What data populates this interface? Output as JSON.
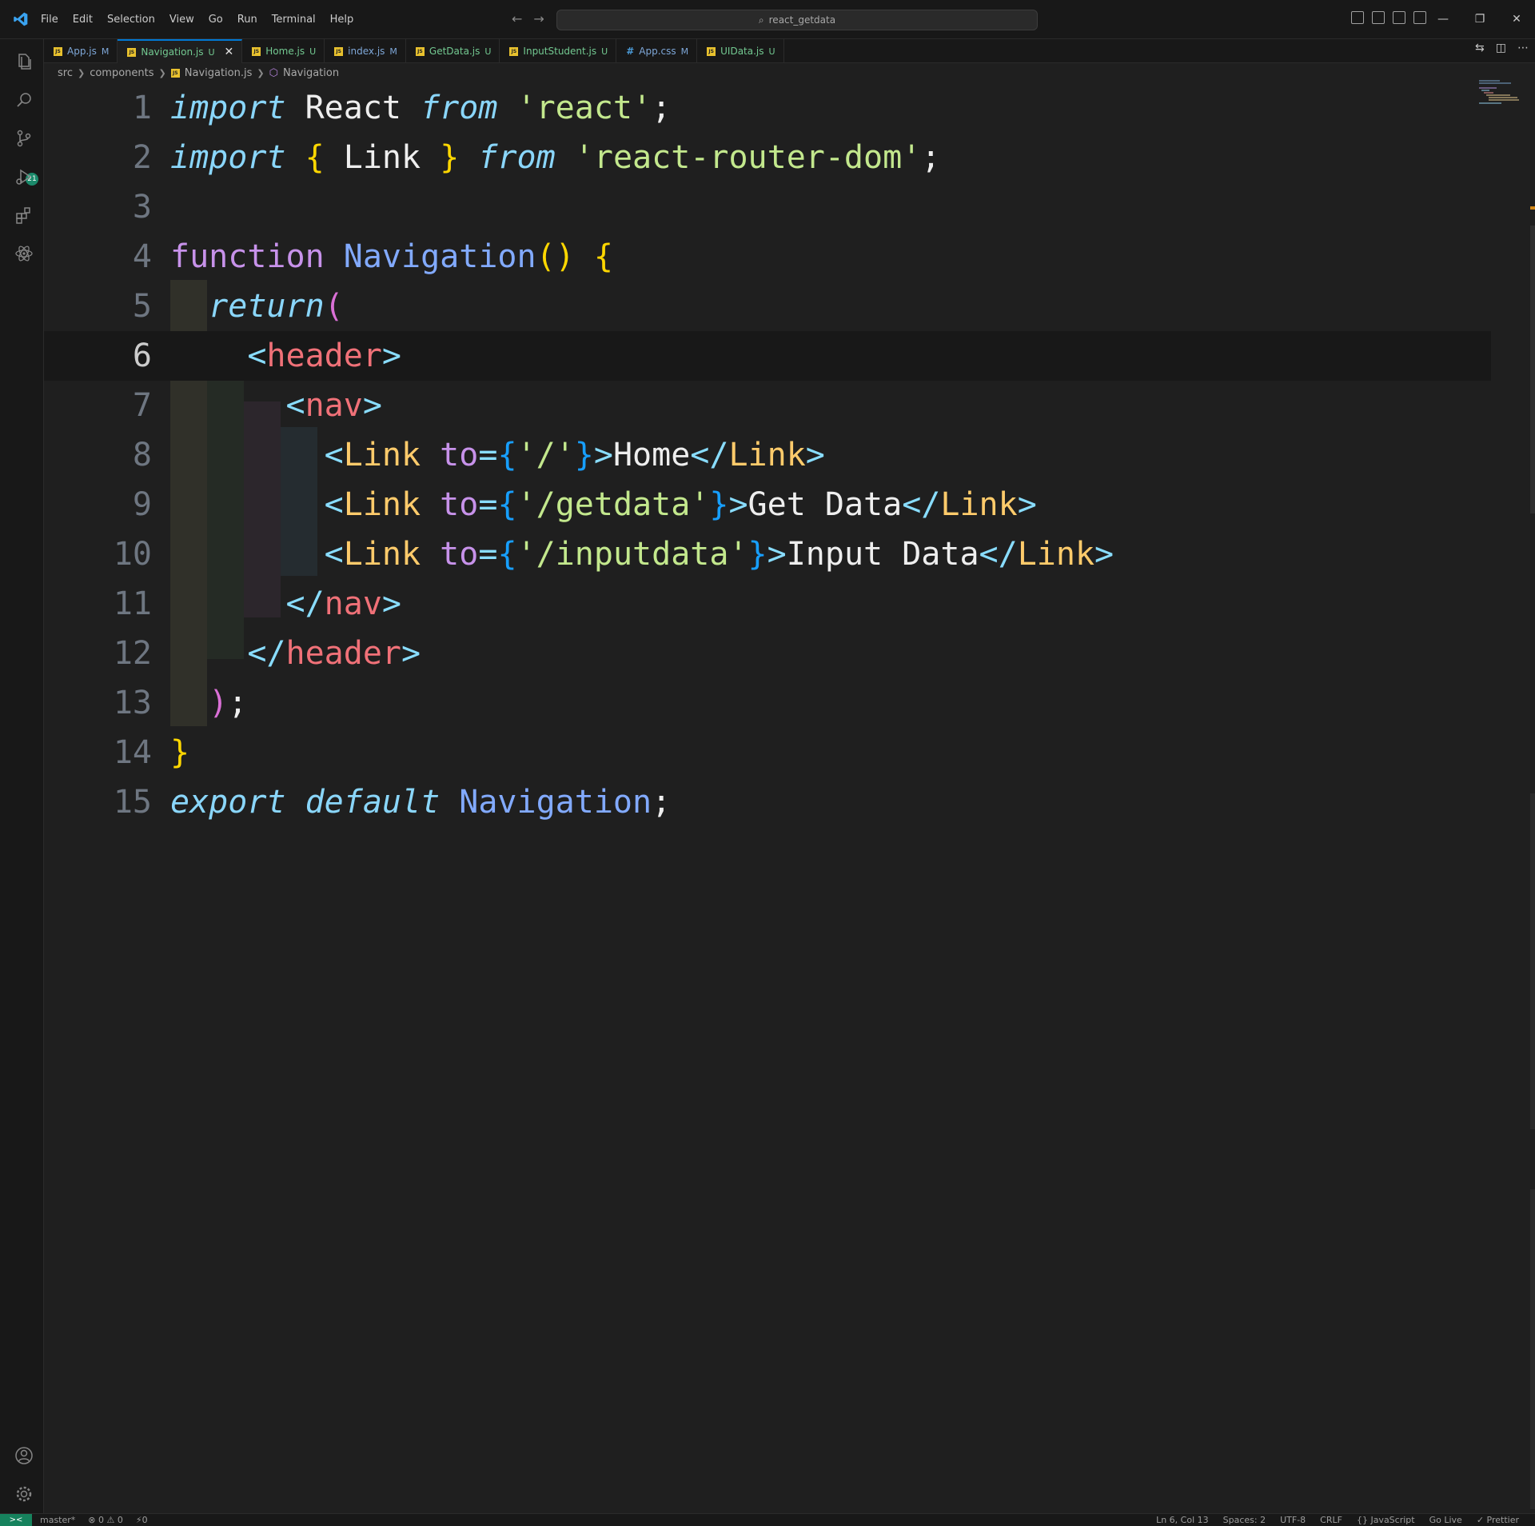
{
  "window": {
    "search_text": "react_getdata"
  },
  "menu": [
    "File",
    "Edit",
    "Selection",
    "View",
    "Go",
    "Run",
    "Terminal",
    "Help"
  ],
  "tabs": [
    {
      "name": "App.js",
      "status": "M",
      "kind": "js",
      "active": false
    },
    {
      "name": "Navigation.js",
      "status": "U",
      "kind": "js",
      "active": true
    },
    {
      "name": "Home.js",
      "status": "U",
      "kind": "js",
      "active": false
    },
    {
      "name": "index.js",
      "status": "M",
      "kind": "js",
      "active": false
    },
    {
      "name": "GetData.js",
      "status": "U",
      "kind": "js",
      "active": false
    },
    {
      "name": "InputStudent.js",
      "status": "U",
      "kind": "js",
      "active": false
    },
    {
      "name": "App.css",
      "status": "M",
      "kind": "css",
      "active": false
    },
    {
      "name": "UIData.js",
      "status": "U",
      "kind": "js",
      "active": false
    }
  ],
  "breadcrumb": {
    "folder1": "src",
    "folder2": "components",
    "file": "Navigation.js",
    "symbol": "Navigation"
  },
  "activity": {
    "scm_badge": "21"
  },
  "code_lines": [
    {
      "n": "1",
      "tokens": [
        [
          "kw-it",
          "import"
        ],
        [
          "ident",
          " React "
        ],
        [
          "kw-it",
          "from"
        ],
        [
          "str",
          " 'react'"
        ],
        [
          "ident",
          ";"
        ]
      ]
    },
    {
      "n": "2",
      "tokens": [
        [
          "kw-it",
          "import"
        ],
        [
          "ident",
          " "
        ],
        [
          "br-y",
          "{"
        ],
        [
          "ident",
          " Link "
        ],
        [
          "br-y",
          "}"
        ],
        [
          "ident",
          " "
        ],
        [
          "kw-it",
          "from"
        ],
        [
          "str",
          " 'react-router-dom'"
        ],
        [
          "ident",
          ";"
        ]
      ]
    },
    {
      "n": "3",
      "tokens": []
    },
    {
      "n": "4",
      "tokens": [
        [
          "kw-fn",
          "function"
        ],
        [
          "ident",
          " "
        ],
        [
          "fn-name",
          "Navigation"
        ],
        [
          "br-y",
          "()"
        ],
        [
          "ident",
          " "
        ],
        [
          "br-y",
          "{"
        ]
      ]
    },
    {
      "n": "5",
      "tokens": [
        [
          "ident",
          "  "
        ],
        [
          "kw-it",
          "return"
        ],
        [
          "br-p",
          "("
        ]
      ]
    },
    {
      "n": "6",
      "tokens": [
        [
          "ident",
          "    "
        ],
        [
          "angle",
          "<"
        ],
        [
          "tag-red",
          "header"
        ],
        [
          "angle",
          ">"
        ]
      ]
    },
    {
      "n": "7",
      "tokens": [
        [
          "ident",
          "      "
        ],
        [
          "angle",
          "<"
        ],
        [
          "tag-red",
          "nav"
        ],
        [
          "angle",
          ">"
        ]
      ]
    },
    {
      "n": "8",
      "tokens": [
        [
          "ident",
          "        "
        ],
        [
          "angle",
          "<"
        ],
        [
          "tag-orange",
          "Link"
        ],
        [
          "ident",
          " "
        ],
        [
          "attr",
          "to"
        ],
        [
          "punc",
          "="
        ],
        [
          "br-b",
          "{"
        ],
        [
          "str",
          "'/'"
        ],
        [
          "br-b",
          "}"
        ],
        [
          "angle",
          ">"
        ],
        [
          "txt",
          "Home"
        ],
        [
          "angle",
          "</"
        ],
        [
          "tag-orange",
          "Link"
        ],
        [
          "angle",
          ">"
        ]
      ]
    },
    {
      "n": "9",
      "tokens": [
        [
          "ident",
          "        "
        ],
        [
          "angle",
          "<"
        ],
        [
          "tag-orange",
          "Link"
        ],
        [
          "ident",
          " "
        ],
        [
          "attr",
          "to"
        ],
        [
          "punc",
          "="
        ],
        [
          "br-b",
          "{"
        ],
        [
          "str",
          "'/getdata'"
        ],
        [
          "br-b",
          "}"
        ],
        [
          "angle",
          ">"
        ],
        [
          "txt",
          "Get Data"
        ],
        [
          "angle",
          "</"
        ],
        [
          "tag-orange",
          "Link"
        ],
        [
          "angle",
          ">"
        ]
      ]
    },
    {
      "n": "10",
      "tokens": [
        [
          "ident",
          "        "
        ],
        [
          "angle",
          "<"
        ],
        [
          "tag-orange",
          "Link"
        ],
        [
          "ident",
          " "
        ],
        [
          "attr",
          "to"
        ],
        [
          "punc",
          "="
        ],
        [
          "br-b",
          "{"
        ],
        [
          "str",
          "'/inputdata'"
        ],
        [
          "br-b",
          "}"
        ],
        [
          "angle",
          ">"
        ],
        [
          "txt",
          "Input Data"
        ],
        [
          "angle",
          "</"
        ],
        [
          "tag-orange",
          "Link"
        ],
        [
          "angle",
          ">"
        ]
      ]
    },
    {
      "n": "11",
      "tokens": [
        [
          "ident",
          "      "
        ],
        [
          "angle",
          "</"
        ],
        [
          "tag-red",
          "nav"
        ],
        [
          "angle",
          ">"
        ]
      ]
    },
    {
      "n": "12",
      "tokens": [
        [
          "ident",
          "    "
        ],
        [
          "angle",
          "</"
        ],
        [
          "tag-red",
          "header"
        ],
        [
          "angle",
          ">"
        ]
      ]
    },
    {
      "n": "13",
      "tokens": [
        [
          "ident",
          "  "
        ],
        [
          "br-p",
          ")"
        ],
        [
          "ident",
          ";"
        ]
      ]
    },
    {
      "n": "14",
      "tokens": [
        [
          "br-y",
          "}"
        ]
      ]
    },
    {
      "n": "15",
      "tokens": [
        [
          "kw-it",
          "export"
        ],
        [
          "ident",
          " "
        ],
        [
          "kw-it",
          "default"
        ],
        [
          "ident",
          " "
        ],
        [
          "fn-name",
          "Navigation"
        ],
        [
          "ident",
          ";"
        ]
      ]
    }
  ],
  "current_line": "6",
  "statusbar": {
    "remote": "><",
    "branch": "master*",
    "problems": "⊗ 0 ⚠ 0",
    "ports": "⚡0",
    "position": "Ln 6, Col 13",
    "spaces": "Spaces: 2",
    "encoding": "UTF-8",
    "eol": "CRLF",
    "language": "{} JavaScript",
    "golive": "Go Live",
    "prettier": "✓ Prettier"
  }
}
